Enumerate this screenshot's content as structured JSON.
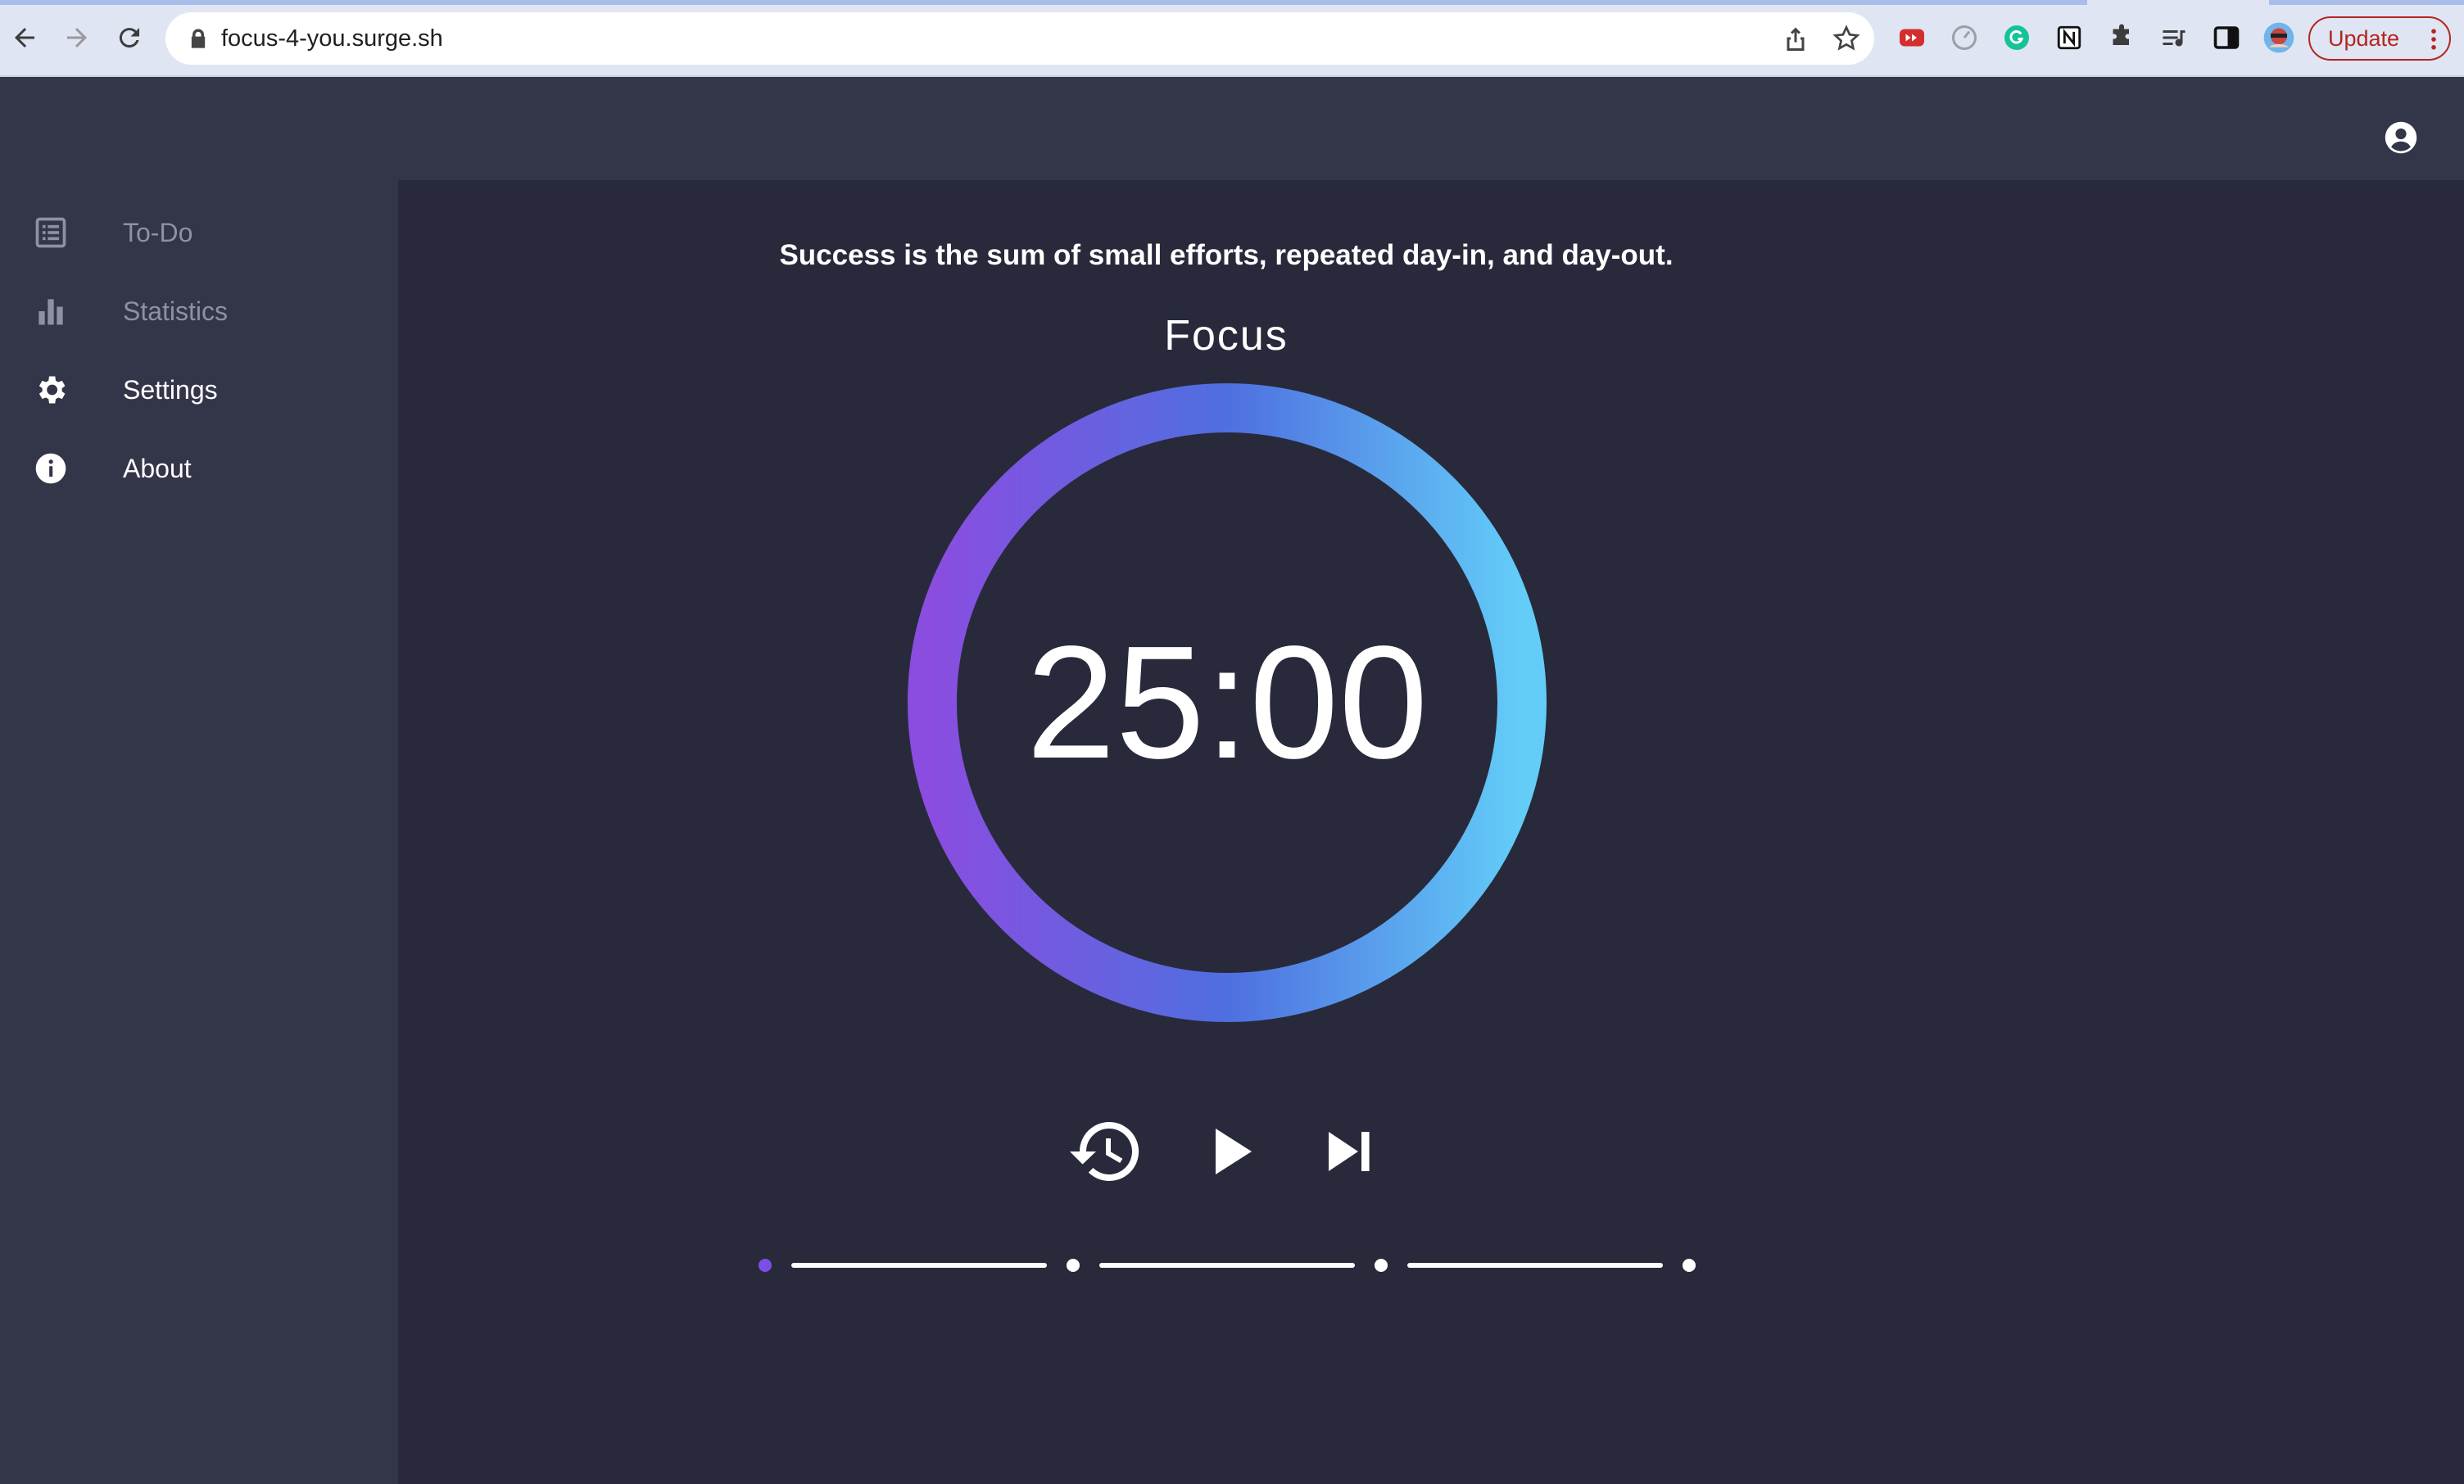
{
  "browser": {
    "url": "focus-4-you.surge.sh",
    "update_label": "Update",
    "icons": [
      "back-icon",
      "forward-icon",
      "reload-icon",
      "lock-icon",
      "share-icon",
      "star-icon",
      "youtube-extension-icon",
      "timer-extension-icon",
      "grammarly-extension-icon",
      "notion-extension-icon",
      "puzzle-extensions-icon",
      "reading-list-icon",
      "side-panel-icon",
      "profile-avatar-icon",
      "more-vert-icon"
    ]
  },
  "header": {
    "account_icon": "account-circle-icon"
  },
  "sidebar": {
    "items": [
      {
        "label": "To-Do",
        "icon": "list-icon",
        "state": "dim"
      },
      {
        "label": "Statistics",
        "icon": "bar-chart-icon",
        "state": "dim"
      },
      {
        "label": "Settings",
        "icon": "gear-icon",
        "state": "active"
      },
      {
        "label": "About",
        "icon": "info-icon",
        "state": "active"
      }
    ]
  },
  "main": {
    "quote": "Success is the sum of small efforts, repeated day-in, and day-out.",
    "mode": "Focus",
    "time": "25:00",
    "controls": [
      "restart-history-icon",
      "play-icon",
      "skip-next-icon"
    ],
    "sessions_total": 4,
    "sessions_current": 1,
    "colors": {
      "ring_start": "#8a4de0",
      "ring_mid": "#4f6fe0",
      "ring_end": "#63cdf8",
      "active_dot": "#7b4fe6"
    }
  }
}
